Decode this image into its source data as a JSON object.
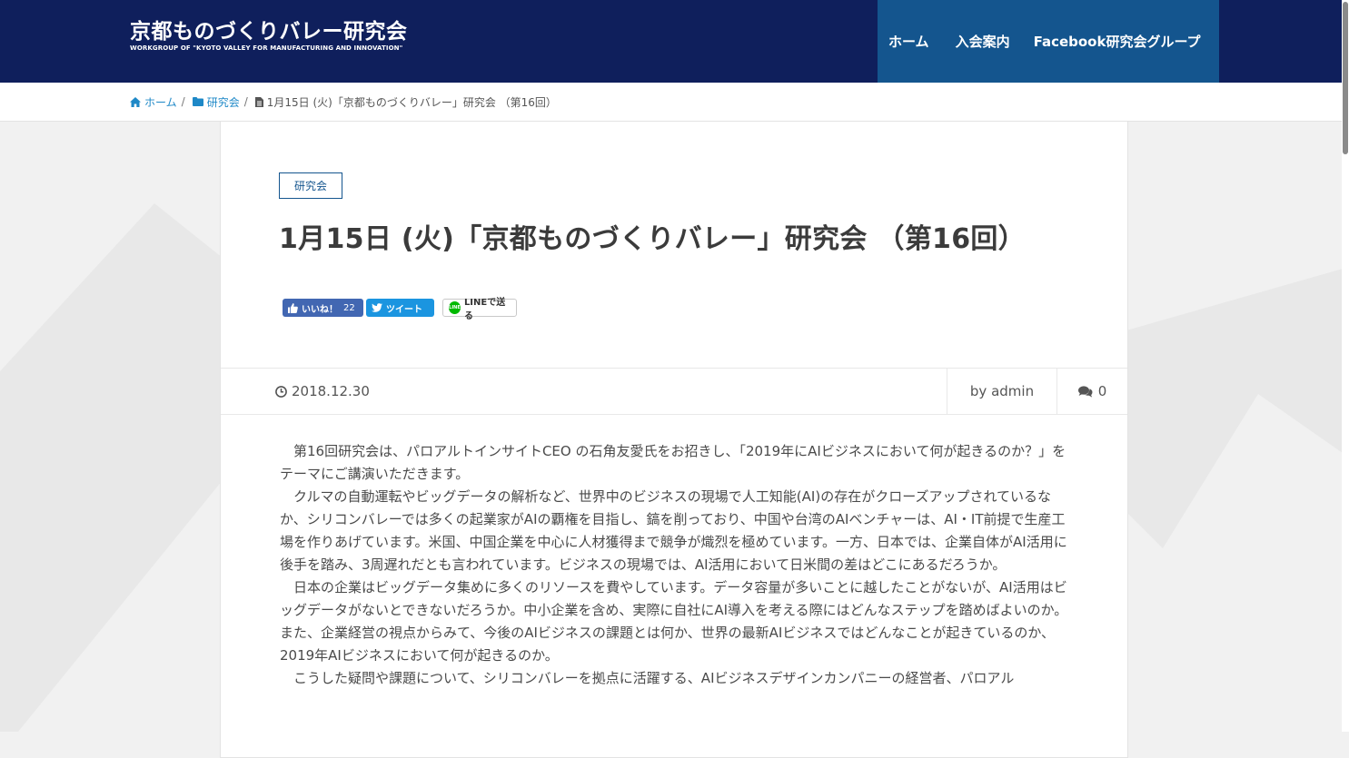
{
  "header": {
    "logo_title": "京都ものづくりバレー研究会",
    "logo_subtitle": "WORKGROUP OF \"KYOTO VALLEY FOR MANUFACTURING AND INNOVATION\"",
    "nav": [
      {
        "label": "ホーム"
      },
      {
        "label": "入会案内"
      },
      {
        "label": "Facebook研究会グループ"
      }
    ]
  },
  "breadcrumb": {
    "home": "ホーム",
    "category": "研究会",
    "current": "1月15日 (火)「京都ものづくりバレー」研究会 （第16回）",
    "separator": "/"
  },
  "article": {
    "category": "研究会",
    "title": "1月15日 (火)「京都ものづくりバレー」研究会 （第16回）",
    "share": {
      "facebook_label": "いいね！",
      "facebook_count": "22",
      "twitter_label": "ツイート",
      "line_label": "LINEで送る",
      "line_icon_text": "LINE"
    },
    "meta": {
      "date": "2018.12.30",
      "author": "by admin",
      "comments": "0"
    },
    "paragraphs": [
      "　第16回研究会は、パロアルトインサイトCEO の石角友愛氏をお招きし、「2019年にAIビジネスにおいて何が起きるのか？」をテーマにご講演いただきます。",
      "　クルマの自動運転やビッグデータの解析など、世界中のビジネスの現場で人工知能(AI)の存在がクローズアップされているなか、シリコンバレーでは多くの起業家がAIの覇権を目指し、鎬を削っており、中国や台湾のAIベンチャーは、AI・IT前提で生産工場を作りあげています。米国、中国企業を中心に人材獲得まで競争が熾烈を極めています。一方、日本では、企業自体がAI活用に後手を踏み、3周遅れだとも言われています。ビジネスの現場では、AI活用において日米間の差はどこにあるだろうか。",
      "　日本の企業はビッグデータ集めに多くのリソースを費やしています。データ容量が多いことに越したことがないが、AI活用はビッグデータがないとできないだろうか。中小企業を含め、実際に自社にAI導入を考える際にはどんなステップを踏めばよいのか。",
      "また、企業経営の視点からみて、今後のAIビジネスの課題とは何か、世界の最新AIビジネスではどんなことが起きているのか、2019年AIビジネスにおいて何が起きるのか。",
      "　こうした疑問や課題について、シリコンバレーを拠点に活躍する、AIビジネスデザインカンパニーの経営者、パロアル"
    ]
  },
  "colors": {
    "header_bg": "#0f1f5c",
    "nav_bg": "#14558e",
    "link": "#1e88c7",
    "facebook": "#4267b2",
    "twitter": "#1b95e0",
    "line": "#00b900"
  },
  "icons": {
    "breadcrumb_home": "home-icon",
    "breadcrumb_category": "folder-icon",
    "breadcrumb_current": "file-icon",
    "date": "clock-icon",
    "comments": "comments-icon"
  }
}
